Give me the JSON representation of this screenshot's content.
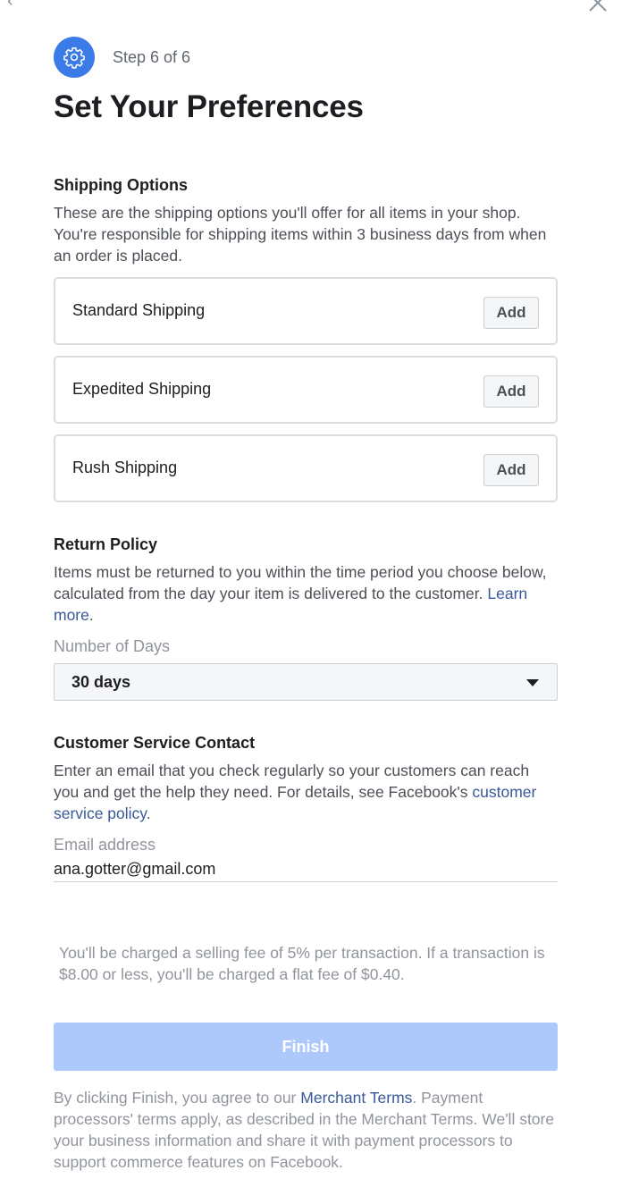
{
  "step": {
    "text": "Step 6 of 6",
    "icon": "gear-icon"
  },
  "title": "Set Your Preferences",
  "shipping": {
    "title": "Shipping Options",
    "description": "These are the shipping options you'll offer for all items in your shop. You're responsible for shipping items within 3 business days from when an order is placed.",
    "options": [
      {
        "label": "Standard Shipping",
        "button": "Add"
      },
      {
        "label": "Expedited Shipping",
        "button": "Add"
      },
      {
        "label": "Rush Shipping",
        "button": "Add"
      }
    ]
  },
  "return_policy": {
    "title": "Return Policy",
    "description": "Items must be returned to you within the time period you choose below, calculated from the day your item is delivered to the customer.",
    "link": "Learn more",
    "link_suffix": ".",
    "days_label": "Number of Days",
    "days_value": "30 days"
  },
  "customer_service": {
    "title": "Customer Service Contact",
    "description": "Enter an email that you check regularly so your customers can reach you and get the help they need. For details, see Facebook's",
    "link": "customer service policy",
    "link_suffix": ".",
    "email_label": "Email address",
    "email_value": "ana.gotter@gmail.com"
  },
  "fee_note": "You'll be charged a selling fee of 5% per transaction. If a transaction is $8.00 or less, you'll be charged a flat fee of $0.40.",
  "finish_label": "Finish",
  "terms": {
    "prefix": "By clicking Finish, you agree to our",
    "link": "Merchant Terms",
    "suffix": ". Payment processors' terms apply, as described in the Merchant Terms. We'll store your business information and share it with payment processors to support commerce features on Facebook."
  },
  "colors": {
    "accent": "#3b7be8",
    "link": "#385898",
    "finish_disabled": "#adc8fb"
  }
}
